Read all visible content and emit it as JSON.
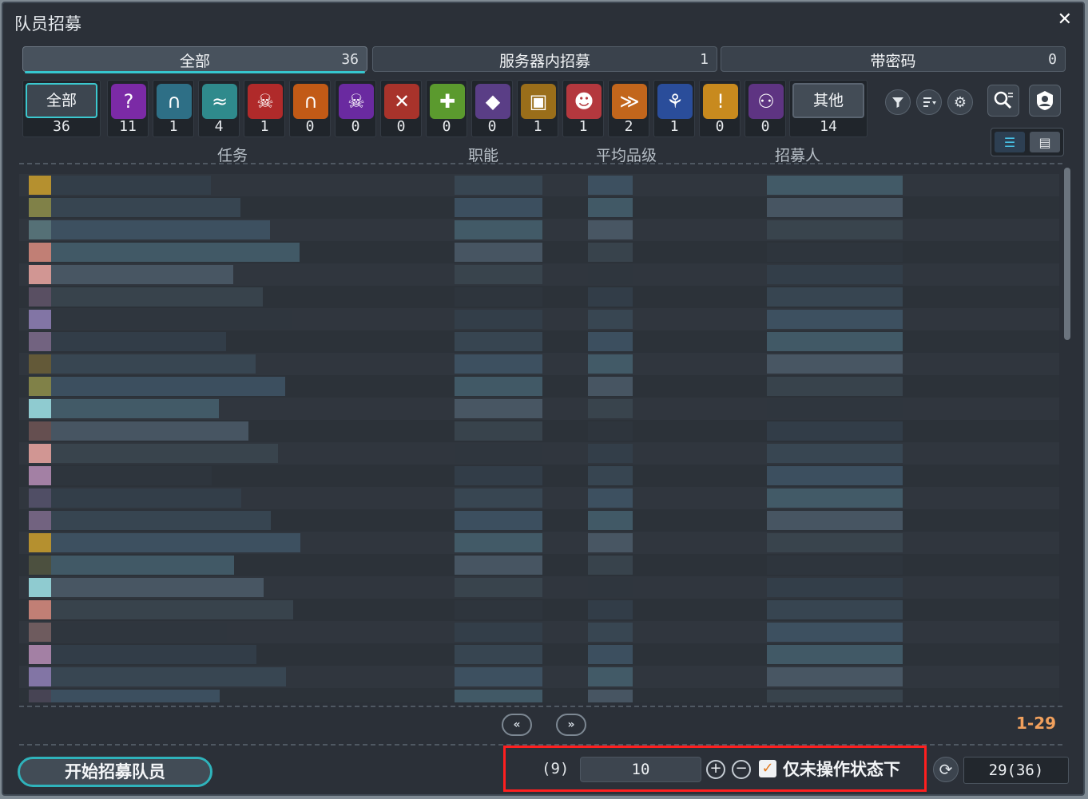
{
  "window": {
    "title": "队员招募",
    "close_icon": "close-icon"
  },
  "tabs": [
    {
      "label": "全部",
      "count": "36"
    },
    {
      "label": "服务器内招募",
      "count": "1"
    },
    {
      "label": "带密码",
      "count": "0"
    }
  ],
  "categories": {
    "all": {
      "label": "全部",
      "count": "36"
    },
    "items": [
      {
        "icon": "question-icon",
        "count": "11",
        "color": "#7b2aa6"
      },
      {
        "icon": "cave-arch-icon",
        "count": "1",
        "color": "#2e6f86"
      },
      {
        "icon": "scroll-icon",
        "count": "4",
        "color": "#2f8a8c"
      },
      {
        "icon": "demon-face-icon",
        "count": "1",
        "color": "#b02a2a"
      },
      {
        "icon": "fire-gate-icon",
        "count": "0",
        "color": "#c25a16"
      },
      {
        "icon": "purple-demon-icon",
        "count": "0",
        "color": "#6a2aa0"
      },
      {
        "icon": "crossed-swords-icon",
        "count": "0",
        "color": "#a8332b"
      },
      {
        "icon": "leaf-plus-icon",
        "count": "0",
        "color": "#5b9a2e"
      },
      {
        "icon": "gem-orb-icon",
        "count": "0",
        "color": "#5a3e86"
      },
      {
        "icon": "treasure-chest-icon",
        "count": "1",
        "color": "#9a6e1a"
      },
      {
        "icon": "red-goblin-icon",
        "count": "1",
        "color": "#b4383e"
      },
      {
        "icon": "fish-icon",
        "count": "2",
        "color": "#c2661c"
      },
      {
        "icon": "tree-icon",
        "count": "1",
        "color": "#2a4d9a"
      },
      {
        "icon": "alert-burst-icon",
        "count": "0",
        "color": "#c88a1e"
      },
      {
        "icon": "group-icon",
        "count": "0",
        "color": "#5e3482"
      }
    ],
    "other": {
      "label": "其他",
      "count": "14"
    }
  },
  "toolbar": {
    "filter_icon": "filter-icon",
    "sort_icon": "sort-list-icon",
    "settings_icon": "gear-icon",
    "search_icon": "search-icon",
    "profile_icon": "profile-shield-icon"
  },
  "columns": {
    "task": "任务",
    "job": "职能",
    "avg_grade": "平均品级",
    "recruiter": "招募人"
  },
  "pagination": {
    "prev": "«",
    "next": "»",
    "range": "1-29"
  },
  "bottom": {
    "start_button": "开始招募队员",
    "filter_count": "(9)",
    "number_value": "10",
    "checkbox_label": "仅未操作状态下",
    "checkbox_checked": true,
    "total": "29(36)"
  }
}
